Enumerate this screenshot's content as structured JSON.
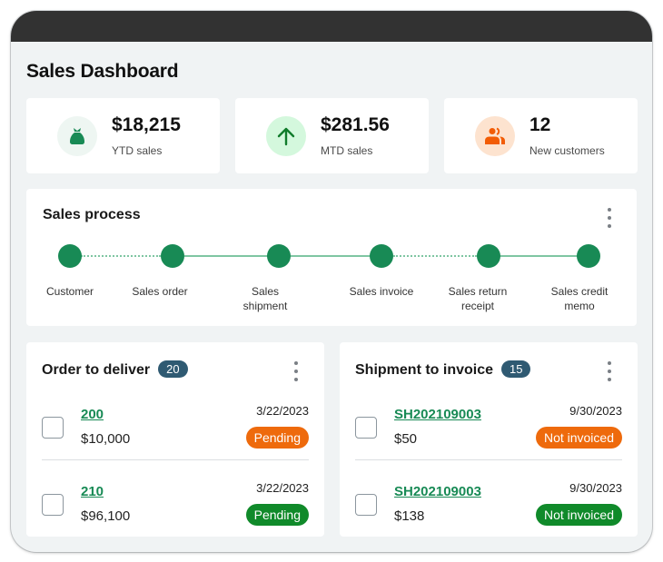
{
  "page_title": "Sales Dashboard",
  "kpis": [
    {
      "value": "$18,215",
      "label": "YTD sales",
      "icon": "money-bag-icon",
      "icon_color": "#188a55",
      "icon_bg": "#eef6f2"
    },
    {
      "value": "$281.56",
      "label": "MTD sales",
      "icon": "arrow-up-icon",
      "icon_color": "#107c2b",
      "icon_bg": "#d4f8dd"
    },
    {
      "value": "12",
      "label": "New customers",
      "icon": "people-icon",
      "icon_color": "#f25c05",
      "icon_bg": "#fde3cf"
    }
  ],
  "sales_process": {
    "title": "Sales process",
    "steps": [
      "Customer",
      "Sales order",
      "Sales shipment",
      "Sales invoice",
      "Sales return receipt",
      "Sales credit memo"
    ],
    "connectors": [
      "dotted",
      "solid",
      "solid",
      "dotted",
      "solid"
    ]
  },
  "order_to_deliver": {
    "title": "Order to deliver",
    "count": "20",
    "rows": [
      {
        "id": "200",
        "amount": "$10,000",
        "date": "3/22/2023",
        "status": "Pending",
        "status_color": "#ee6a0c"
      },
      {
        "id": "210",
        "amount": "$96,100",
        "date": "3/22/2023",
        "status": "Pending",
        "status_color": "#108a2a"
      }
    ]
  },
  "shipment_to_invoice": {
    "title": "Shipment to invoice",
    "count": "15",
    "rows": [
      {
        "id": "SH202109003",
        "amount": "$50",
        "date": "9/30/2023",
        "status": "Not invoiced",
        "status_color": "#ee6a0c"
      },
      {
        "id": "SH202109003",
        "amount": "$138",
        "date": "9/30/2023",
        "status": "Not invoiced",
        "status_color": "#108a2a"
      }
    ]
  },
  "colors": {
    "accent": "#188a55",
    "topbar": "#323232",
    "count_badge": "#2f5a72"
  }
}
